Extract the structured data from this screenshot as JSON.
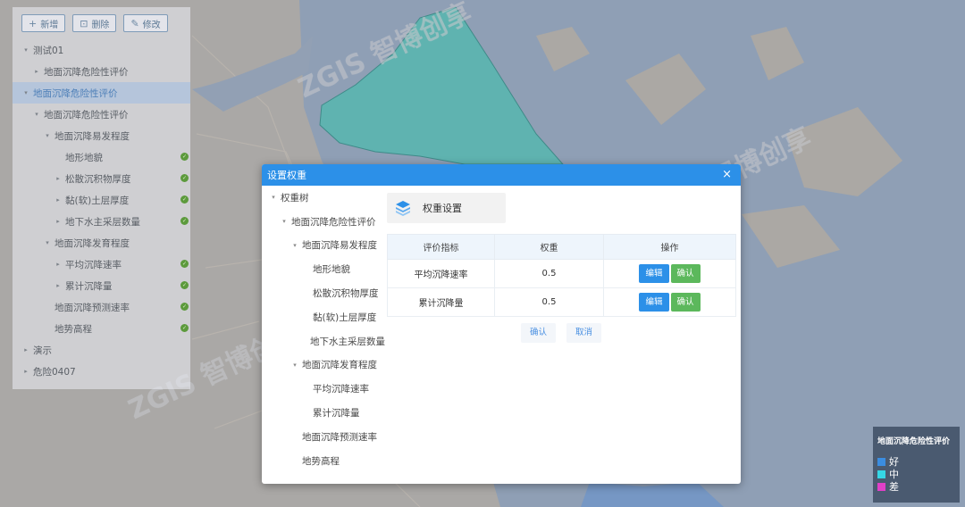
{
  "toolbar": {
    "add": {
      "icon": "+",
      "label": "新增"
    },
    "delete": {
      "icon": "⊡",
      "label": "删除"
    },
    "edit": {
      "icon": "✎",
      "label": "修改"
    }
  },
  "tree": [
    {
      "label": "测试01",
      "caret": "▾",
      "indent": 0,
      "ok": false,
      "active": false
    },
    {
      "label": "地面沉降危险性评价",
      "caret": "▸",
      "indent": 1,
      "ok": false,
      "active": false
    },
    {
      "label": "地面沉降危险性评价",
      "caret": "▾",
      "indent": 0,
      "ok": false,
      "active": true
    },
    {
      "label": "地面沉降危险性评价",
      "caret": "▾",
      "indent": 1,
      "ok": false,
      "active": false
    },
    {
      "label": "地面沉降易发程度",
      "caret": "▾",
      "indent": 2,
      "ok": false,
      "active": false
    },
    {
      "label": "地形地貌",
      "caret": "",
      "indent": 3,
      "ok": true,
      "active": false
    },
    {
      "label": "松散沉积物厚度",
      "caret": "▸",
      "indent": 3,
      "ok": true,
      "active": false
    },
    {
      "label": "黏(软)土层厚度",
      "caret": "▸",
      "indent": 3,
      "ok": true,
      "active": false
    },
    {
      "label": "地下水主采层数量",
      "caret": "▸",
      "indent": 3,
      "ok": true,
      "active": false
    },
    {
      "label": "地面沉降发育程度",
      "caret": "▾",
      "indent": 2,
      "ok": false,
      "active": false
    },
    {
      "label": "平均沉降速率",
      "caret": "▸",
      "indent": 3,
      "ok": true,
      "active": false
    },
    {
      "label": "累计沉降量",
      "caret": "▸",
      "indent": 3,
      "ok": true,
      "active": false
    },
    {
      "label": "地面沉降预测速率",
      "caret": "",
      "indent": 2,
      "ok": true,
      "active": false
    },
    {
      "label": "地势高程",
      "caret": "",
      "indent": 2,
      "ok": true,
      "active": false
    },
    {
      "label": "演示",
      "caret": "▸",
      "indent": 0,
      "ok": false,
      "active": false
    },
    {
      "label": "危险0407",
      "caret": "▸",
      "indent": 0,
      "ok": false,
      "active": false
    }
  ],
  "dialog": {
    "title": "设置权重",
    "close": "×",
    "tree": [
      {
        "label": "权重树",
        "caret": "▾",
        "indent": 0
      },
      {
        "label": "地面沉降危险性评价",
        "caret": "▾",
        "indent": 1
      },
      {
        "label": "地面沉降易发程度",
        "caret": "▾",
        "indent": 2
      },
      {
        "label": "地形地貌",
        "caret": "",
        "indent": 3
      },
      {
        "label": "松散沉积物厚度",
        "caret": "",
        "indent": 3
      },
      {
        "label": "黏(软)土层厚度",
        "caret": "",
        "indent": 3
      },
      {
        "label": "地下水主采层数量",
        "caret": "",
        "indent": 3
      },
      {
        "label": "地面沉降发育程度",
        "caret": "▾",
        "indent": 2
      },
      {
        "label": "平均沉降速率",
        "caret": "",
        "indent": 3
      },
      {
        "label": "累计沉降量",
        "caret": "",
        "indent": 3
      },
      {
        "label": "地面沉降预测速率",
        "caret": "",
        "indent": 2
      },
      {
        "label": "地势高程",
        "caret": "",
        "indent": 2
      }
    ],
    "panel_title": "权重设置",
    "columns": [
      "评价指标",
      "权重",
      "操作"
    ],
    "rows": [
      {
        "indicator": "平均沉降速率",
        "weight": "0.5",
        "edit": "编辑",
        "confirm": "确认"
      },
      {
        "indicator": "累计沉降量",
        "weight": "0.5",
        "edit": "编辑",
        "confirm": "确认"
      }
    ],
    "confirm_label": "确认",
    "cancel_label": "取消"
  },
  "legend": {
    "title": "地面沉降危险性评价",
    "items": [
      {
        "label": "好",
        "color": "#3b8de0"
      },
      {
        "label": "中",
        "color": "#35d7e6"
      },
      {
        "label": "差",
        "color": "#e040c8"
      }
    ]
  },
  "watermark": [
    "ZGIS 智博创享",
    "ZGIS 智博创享",
    "ZGIS 智博创享"
  ],
  "colors": {
    "accent": "#2c90e8",
    "success": "#5cb85c",
    "region": "#5fb3b0"
  }
}
